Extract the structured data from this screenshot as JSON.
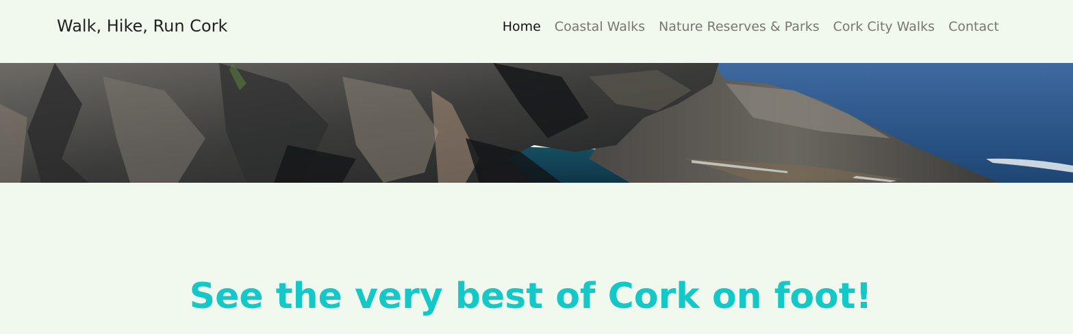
{
  "header": {
    "brand": "Walk, Hike, Run Cork"
  },
  "nav": {
    "items": [
      {
        "label": "Home",
        "active": true
      },
      {
        "label": "Coastal Walks",
        "active": false
      },
      {
        "label": "Nature Reserves & Parks",
        "active": false
      },
      {
        "label": "Cork City Walks",
        "active": false
      },
      {
        "label": "Contact",
        "active": false
      }
    ]
  },
  "hero": {
    "image": "coastal-cliffs-sea-photo"
  },
  "main": {
    "tagline": "See the very best of Cork on foot!"
  },
  "colors": {
    "background": "#f1f9ef",
    "tagline": "#14c8c8",
    "nav_active": "#111111",
    "nav_inactive": "#77776f"
  }
}
